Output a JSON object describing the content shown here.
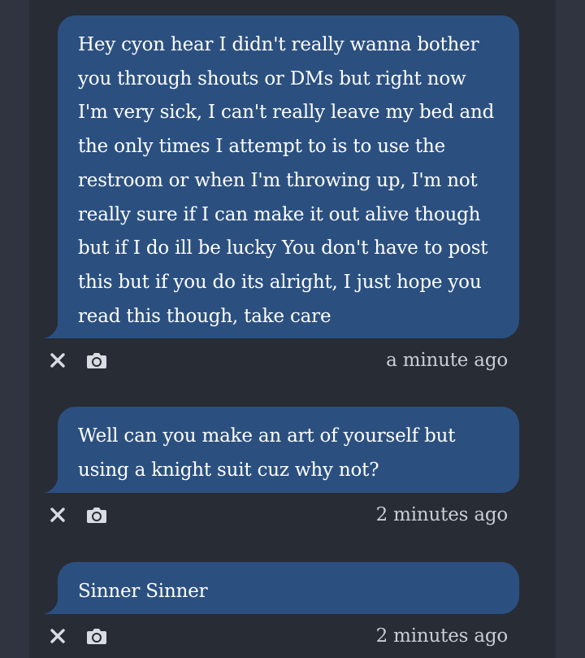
{
  "messages": [
    {
      "text": "Hey cyon hear I didn't really wanna bother you through shouts or DMs but right now I'm very sick, I can't really leave my bed and the only times I attempt to is to use the restroom or when I'm throwing up, I'm not really sure if I can make it out alive though but if I do ill be lucky You don't have to post this but if you do its alright, I just hope you read this though, take care",
      "timestamp": "a minute ago",
      "actions": [
        "close-icon",
        "camera-icon"
      ]
    },
    {
      "text": "Well can you make an art of yourself but using a knight suit cuz why not?",
      "timestamp": "2 minutes ago",
      "actions": [
        "close-icon",
        "camera-icon"
      ]
    },
    {
      "text": "Sinner Sinner",
      "timestamp": "2 minutes ago",
      "actions": [
        "close-icon",
        "camera-icon"
      ]
    }
  ],
  "colors": {
    "background": "#282c35",
    "bubble": "#2b5080",
    "text": "#ffffff",
    "timestamp": "#c9cdd4",
    "icon": "#d9dce1"
  }
}
